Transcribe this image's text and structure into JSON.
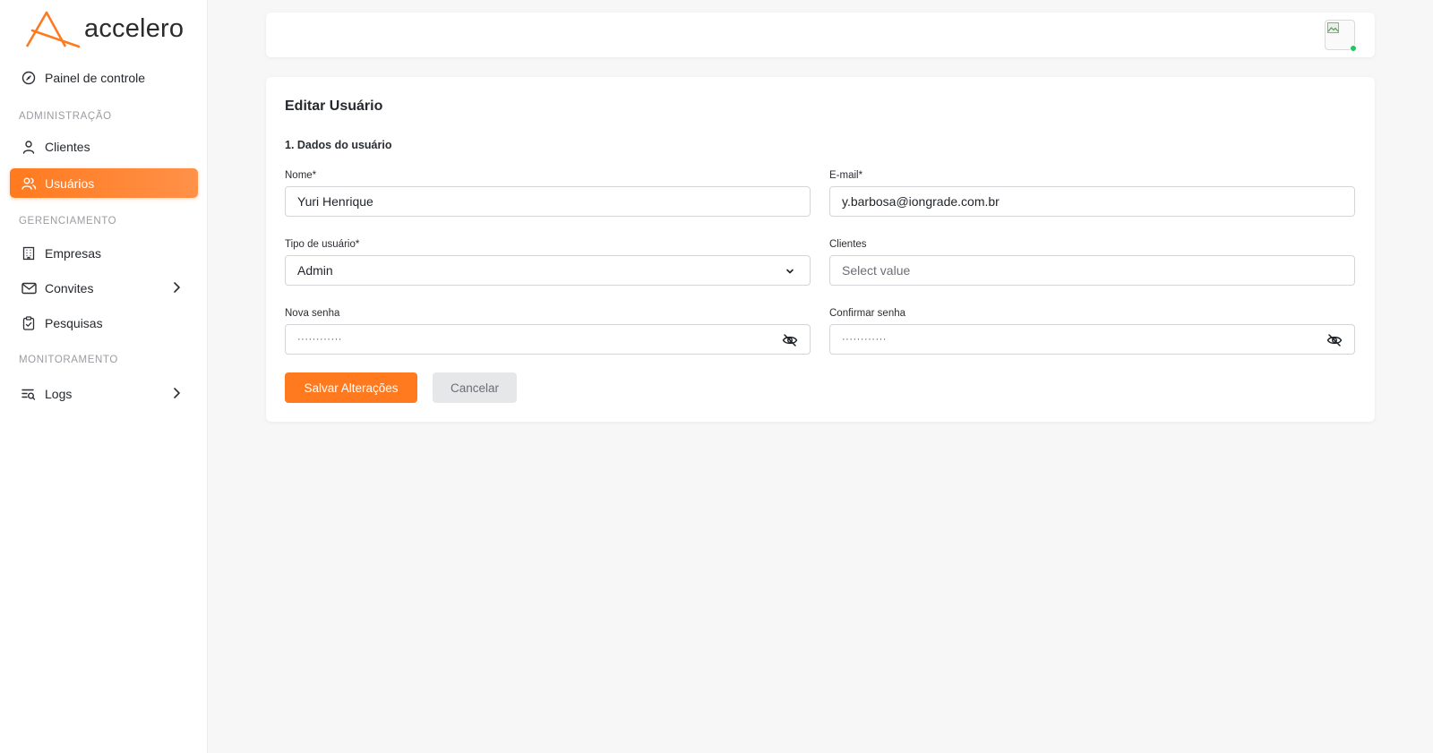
{
  "app": {
    "brand": "accelero",
    "colors": {
      "accent": "#ff7a1f",
      "online": "#22c55e"
    }
  },
  "sidebar": {
    "items": {
      "dashboard": {
        "label": "Painel de controle",
        "icon": "dashboard-gauge-icon"
      },
      "clients": {
        "label": "Clientes",
        "icon": "user-icon"
      },
      "users": {
        "label": "Usuários",
        "icon": "users-icon",
        "active": true
      },
      "companies": {
        "label": "Empresas",
        "icon": "building-icon"
      },
      "invites": {
        "label": "Convites",
        "icon": "mail-icon"
      },
      "surveys": {
        "label": "Pesquisas",
        "icon": "clipboard-check-icon"
      },
      "logs": {
        "label": "Logs",
        "icon": "logs-search-icon"
      }
    },
    "sections": {
      "admin": "ADMINISTRAÇÃO",
      "management": "GERENCIAMENTO",
      "monitoring": "MONITORAMENTO"
    }
  },
  "form": {
    "title": "Editar Usuário",
    "section_title": "1. Dados do usuário",
    "name": {
      "label": "Nome*",
      "value": "Yuri Henrique"
    },
    "email": {
      "label": "E-mail*",
      "value": "y.barbosa@iongrade.com.br"
    },
    "user_type": {
      "label": "Tipo de usuário*",
      "value": "Admin"
    },
    "clients": {
      "label": "Clientes",
      "placeholder": "Select value"
    },
    "new_password": {
      "label": "Nova senha",
      "masked": "············"
    },
    "confirm_password": {
      "label": "Confirmar senha",
      "masked": "············"
    },
    "save_label": "Salvar Alterações",
    "cancel_label": "Cancelar"
  }
}
